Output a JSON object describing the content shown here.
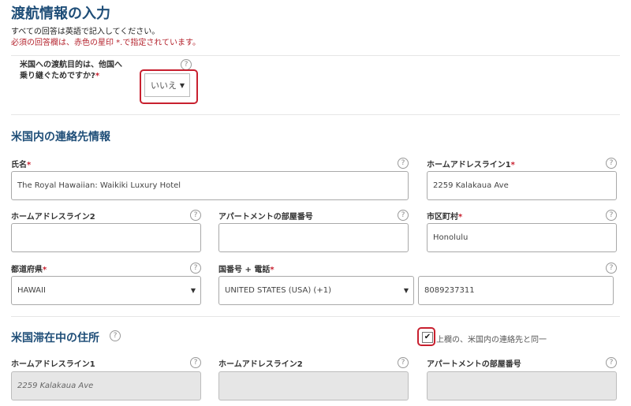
{
  "page": {
    "title": "渡航情報の入力",
    "intro_line1": "すべての回答は英語で記入してください。",
    "intro_line2": "必須の回答欄は、赤色の星印 *.で指定されています。"
  },
  "transit": {
    "question_line1": "米国への渡航目的は、他国へ",
    "question_line2": "乗り継ぐためですか?",
    "required_mark": "*",
    "selected": "いいえ",
    "arrow": "▼"
  },
  "contact": {
    "heading": "米国内の連絡先情報",
    "name_label": "氏名",
    "name_value": "The Royal Hawaiian: Waikiki Luxury Hotel",
    "addr1_label": "ホームアドレスライン1",
    "addr1_value": "2259 Kalakaua Ave",
    "addr2_label": "ホームアドレスライン2",
    "addr2_value": "",
    "apt_label": "アパートメントの部屋番号",
    "apt_value": "",
    "city_label": "市区町村",
    "city_value": "Honolulu",
    "state_label": "都道府県",
    "state_value": "HAWAII",
    "phone_label": "国番号 + 電話",
    "country_code_value": "UNITED STATES (USA) (+1)",
    "phone_value": "8089237311"
  },
  "stay": {
    "heading": "米国滞在中の住所",
    "same_as_label": "上欄の、米国内の連絡先と同一",
    "same_as_checked": true,
    "addr1_label": "ホームアドレスライン1",
    "addr1_value": "2259 Kalakaua Ave",
    "addr2_label": "ホームアドレスライン2",
    "addr2_value": "",
    "apt_label": "アパートメントの部屋番号",
    "apt_value": ""
  },
  "icons": {
    "help": "question-circle-icon",
    "check": "checkmark-icon",
    "dropdown": "triangle-down-icon"
  },
  "colors": {
    "heading": "#1f4e78",
    "required": "#c8202f",
    "highlight": "#c8202f",
    "readonly_bg": "#e6e6e6"
  },
  "glyphs": {
    "help": "?",
    "check": "✔",
    "star": "*"
  }
}
